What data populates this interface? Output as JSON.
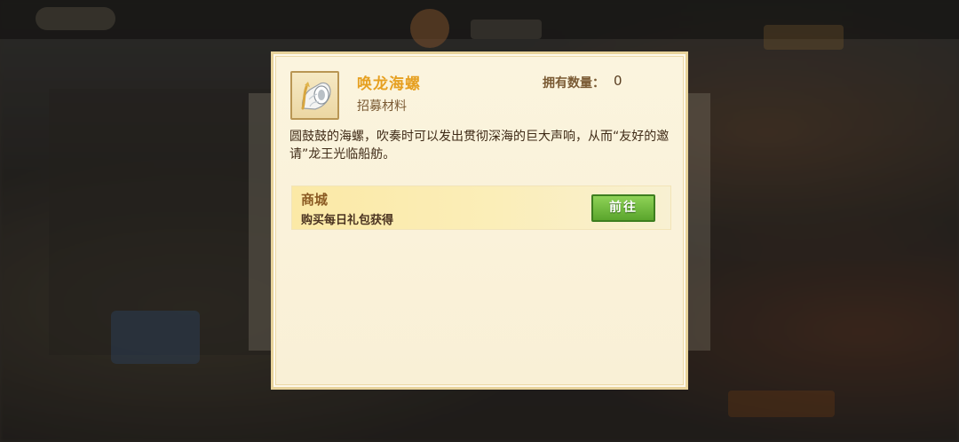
{
  "item": {
    "name": "唤龙海螺",
    "type": "招募材料",
    "owned_label": "拥有数量：",
    "owned_count": "0",
    "icon": "conch-shell-icon",
    "description": "圆鼓鼓的海螺，吹奏时可以发出贯彻深海的巨大声响，从而“友好的邀请”龙王光临船舫。"
  },
  "source": {
    "title": "商城",
    "description": "购买每日礼包获得",
    "button_label": "前往"
  },
  "colors": {
    "name": "#e6a021",
    "button": "#5aa52c",
    "panel": "#fbf4de"
  }
}
